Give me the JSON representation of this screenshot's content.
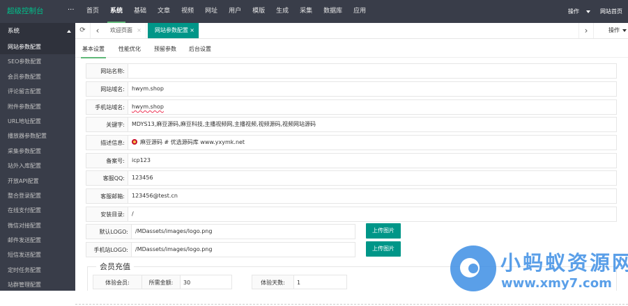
{
  "header": {
    "brand": "超级控制台",
    "more": "···",
    "nav": [
      "首页",
      "系统",
      "基础",
      "文章",
      "视频",
      "网址",
      "用户",
      "模版",
      "生成",
      "采集",
      "数据库",
      "应用"
    ],
    "active_nav": "系统",
    "ops_label": "操作",
    "site_home": "网站首页"
  },
  "sidebar": {
    "section": "系统",
    "items": [
      "网站参数配置",
      "SEO参数配置",
      "会员参数配置",
      "评论留言配置",
      "附件参数配置",
      "URL地址配置",
      "播放器参数配置",
      "采集参数配置",
      "站外入库配置",
      "开放API配置",
      "整合登录配置",
      "在线支付配置",
      "微信对接配置",
      "邮件发送配置",
      "短信发送配置",
      "定时任务配置",
      "站群管理配置"
    ],
    "active": "网站参数配置"
  },
  "tabbar": {
    "tabs": [
      {
        "label": "欢迎页面",
        "close": "×"
      },
      {
        "label": "网站参数配置",
        "close": "×"
      }
    ],
    "ops_label": "操作"
  },
  "subtabs": [
    "基本设置",
    "性能优化",
    "预留参数",
    "后台设置"
  ],
  "form": {
    "rows": [
      {
        "label": "网站名称:",
        "value": ""
      },
      {
        "label": "网站域名:",
        "value": "hwym.shop"
      },
      {
        "label": "手机站域名:",
        "value": "hwym.shop"
      },
      {
        "label": "关键字:",
        "value": "MDYS13,麻豆源码,麻豆科技,主播视频网,主播视频,视频源码,视频网站源码"
      },
      {
        "label": "描述信息:",
        "value": "麻豆源码 # 优选源码库  www.yxymk.net"
      },
      {
        "label": "备案号:",
        "value": "icp123"
      },
      {
        "label": "客服QQ:",
        "value": "123456"
      },
      {
        "label": "客服邮箱:",
        "value": "123456@test.cn"
      },
      {
        "label": "安装目录:",
        "value": "/"
      },
      {
        "label": "默认LOGO:",
        "value": "/MDassets/images/logo.png",
        "button": "上传图片"
      },
      {
        "label": "手机站LOGO:",
        "value": "/MDassets/images/logo.png",
        "button": "上传图片"
      }
    ]
  },
  "vip": {
    "legend": "会员充值",
    "trial_member_label": "体验会员:",
    "amount_label": "所需金额:",
    "amount_value": "30",
    "days_label": "体验天数:",
    "days_value": "1"
  },
  "watermark": {
    "title": "小蚂蚁资源网",
    "url": "www.xmy7.com"
  },
  "colors": {
    "dark": "#393d49",
    "accent": "#009688",
    "brand": "#00c08b",
    "active_line": "#5fb878"
  }
}
